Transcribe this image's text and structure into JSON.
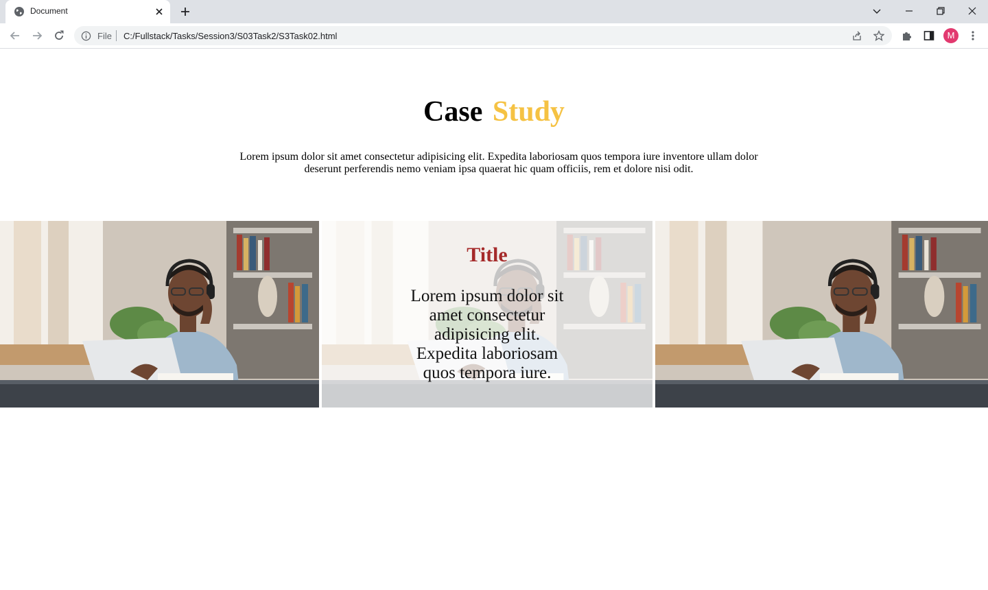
{
  "browser": {
    "tab_title": "Document",
    "scheme_label": "File",
    "url": "C:/Fullstack/Tasks/Session3/S03Task2/S3Task02.html",
    "profile_initial": "M",
    "profile_color": "#e2396f"
  },
  "page": {
    "heading_part1": "Case",
    "heading_part2": "Study",
    "heading_accent_color": "#f5c243",
    "intro": "Lorem ipsum dolor sit amet consectetur adipisicing elit. Expedita laboriosam quos tempora iure inventore ullam dolor deserunt perferendis nemo veniam ipsa quaerat hic quam officiis, rem et dolore nisi odit.",
    "cards": [
      {
        "image": "man-with-headphones-laptop-photo"
      },
      {
        "image": "man-with-headphones-laptop-photo",
        "title": "Title",
        "text": "Lorem ipsum dolor sit amet consectetur adipisicing elit. Expedita laboriosam quos tempora iure.",
        "title_color": "#a52a2a"
      },
      {
        "image": "man-with-headphones-laptop-photo"
      }
    ]
  }
}
